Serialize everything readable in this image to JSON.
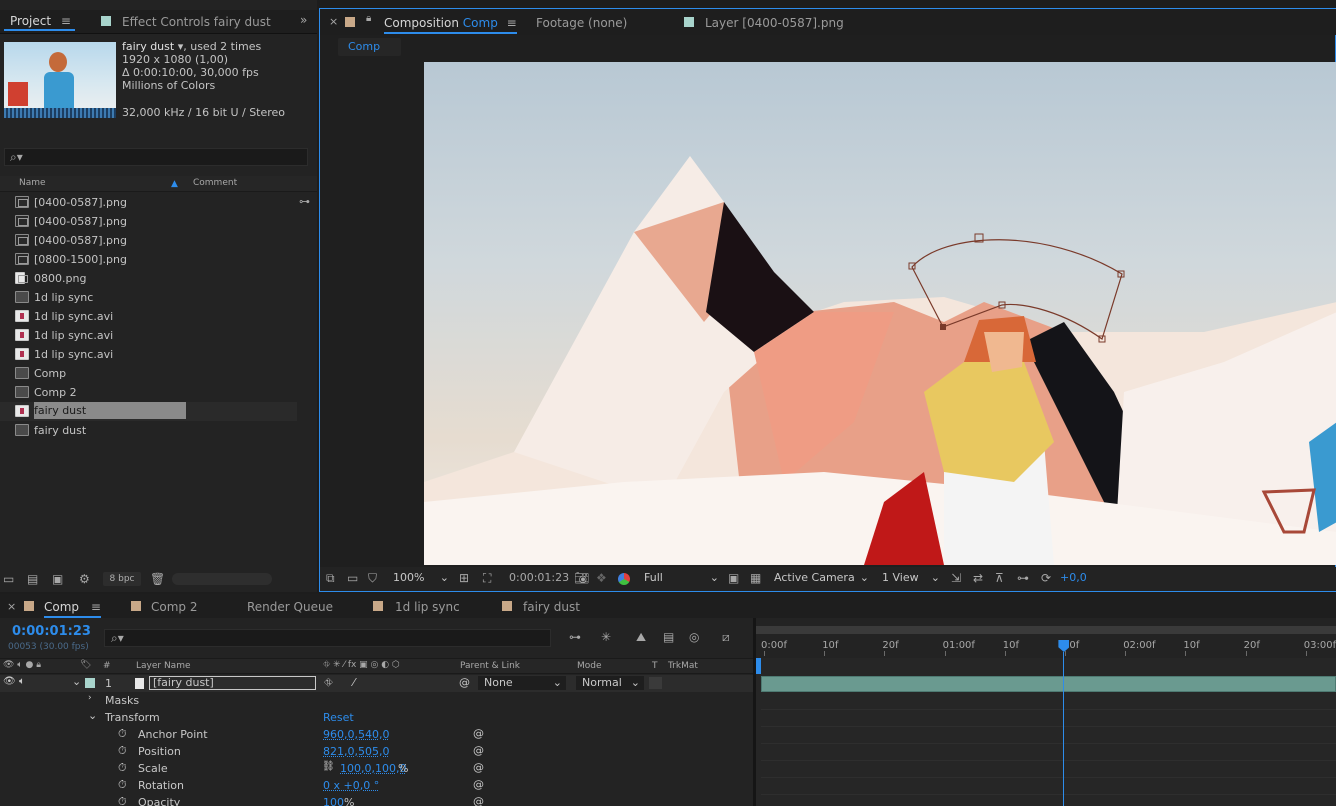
{
  "project": {
    "tab_label": "Project",
    "effect_tab_label": "Effect Controls fairy dust",
    "selected": {
      "name": "fairy dust",
      "used": ", used 2 times",
      "dims": "1920 x 1080 (1,00)",
      "duration": "Δ 0:00:10:00, 30,000 fps",
      "colors": "Millions of Colors",
      "audio": "32,000 kHz / 16 bit U / Stereo"
    },
    "search_placeholder": "",
    "col_name": "Name",
    "col_comment": "Comment",
    "items": [
      {
        "label": "[0400-0587].png",
        "type": "img"
      },
      {
        "label": "[0400-0587].png",
        "type": "img"
      },
      {
        "label": "[0400-0587].png",
        "type": "img"
      },
      {
        "label": "[0800-1500].png",
        "type": "img"
      },
      {
        "label": "0800.png",
        "type": "file"
      },
      {
        "label": "1d lip sync",
        "type": "comp"
      },
      {
        "label": "1d lip sync.avi",
        "type": "vid"
      },
      {
        "label": "1d lip sync.avi",
        "type": "vid"
      },
      {
        "label": "1d lip sync.avi",
        "type": "vid"
      },
      {
        "label": "Comp",
        "type": "comp"
      },
      {
        "label": "Comp 2",
        "type": "comp"
      },
      {
        "label": "fairy dust",
        "type": "vid"
      },
      {
        "label": "fairy dust",
        "type": "comp"
      }
    ],
    "bpc": "8 bpc"
  },
  "viewer": {
    "comp_tab_prefix": "Composition",
    "comp_tab_name": "Comp",
    "footage_tab": "Footage  (none)",
    "layer_tab": "Layer  [0400-0587].png",
    "breadcrumb": "Comp",
    "zoom": "100%",
    "time": "0:00:01:23",
    "resolution": "Full",
    "camera": "Active Camera",
    "views": "1 View",
    "exposure": "+0,0"
  },
  "timeline": {
    "tabs": [
      "Comp",
      "Comp 2",
      "Render Queue",
      "1d lip sync",
      "fairy dust"
    ],
    "current_time": "0:00:01:23",
    "frame_info": "00053 (30.00 fps)",
    "col_num": "#",
    "col_layer_name": "Layer Name",
    "col_parent": "Parent & Link",
    "col_mode": "Mode",
    "col_t": "T",
    "col_trkmat": "TrkMat",
    "layer": {
      "num": "1",
      "name": "[fairy dust]",
      "parent": "None",
      "mode": "Normal"
    },
    "masks_label": "Masks",
    "transform_label": "Transform",
    "reset_label": "Reset",
    "props": [
      {
        "name": "Anchor Point",
        "value": "960,0,540,0"
      },
      {
        "name": "Position",
        "value": "821,0,505,0"
      },
      {
        "name": "Scale",
        "value": "100,0,100,0",
        "unit": "%"
      },
      {
        "name": "Rotation",
        "value": "0 x +0,0 °"
      },
      {
        "name": "Opacity",
        "value": "100",
        "unit": "%"
      }
    ],
    "ruler": [
      "0:00f",
      "10f",
      "20f",
      "01:00f",
      "10f",
      "20f",
      "02:00f",
      "10f",
      "20f",
      "03:00f"
    ],
    "playhead_fraction": 0.53
  }
}
